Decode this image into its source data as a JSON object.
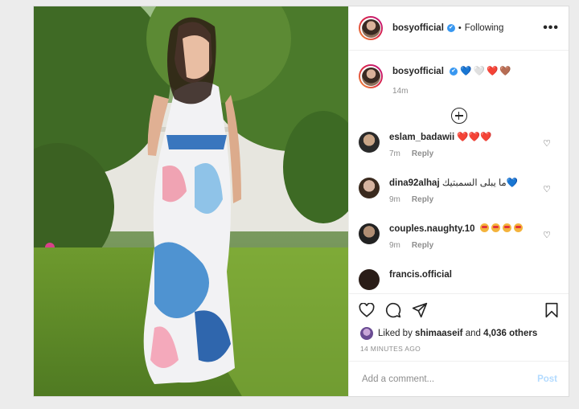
{
  "post": {
    "username": "bosyofficial",
    "follow_status": "Following",
    "separator": "•",
    "more_label": "•••",
    "caption_hearts": "💙🤍❤️🤎",
    "caption_time": "14m",
    "comments": [
      {
        "user": "eslam_badawii",
        "text": "❤️❤️❤️",
        "time": "7m",
        "reply": "Reply"
      },
      {
        "user": "dina92alhaj",
        "text": "ما يبلى السمبتيك💙",
        "time": "9m",
        "reply": "Reply"
      },
      {
        "user": "couples.naughty.10",
        "text": "",
        "time": "9m",
        "reply": "Reply"
      },
      {
        "user": "francis.official",
        "text": "",
        "time": "",
        "reply": ""
      }
    ],
    "liked_by_prefix": "Liked by",
    "liked_by_user": "shimaaseif",
    "liked_by_and": "and",
    "liked_by_count": "4,036 others",
    "posted_time": "14 MINUTES AGO",
    "comment_placeholder": "Add a comment...",
    "post_label": "Post"
  },
  "colors": {
    "verified": "#3897f0",
    "post_button_disabled": "#b3dbff",
    "muted": "#8e8e8e"
  },
  "icons": [
    "heart-icon",
    "comment-icon",
    "share-icon",
    "bookmark-icon",
    "plus-circle-icon",
    "verified-icon",
    "more-icon"
  ]
}
